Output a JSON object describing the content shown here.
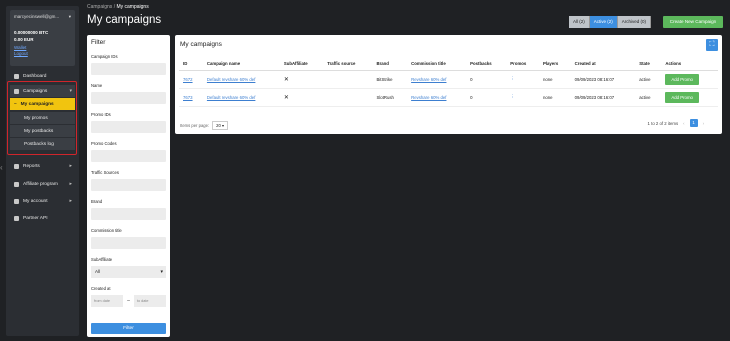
{
  "sidebar": {
    "email": "marcyecinswell@gm...",
    "btc": "0.00000000  BTC",
    "eur": "0.00  EUR",
    "wallet_link": "Wallet",
    "logout_link": "Logout",
    "items": {
      "dashboard": "Dashboard",
      "campaigns": "Campaigns",
      "my_campaigns": "My campaigns",
      "my_promos": "My promos",
      "my_postbacks": "My postbacks",
      "postbacks_log": "Postbacks log",
      "reports": "Reports",
      "affiliate_program": "Affiliate program",
      "my_account": "My account",
      "partner_api": "Partner API"
    }
  },
  "header": {
    "breadcrumb_parent": "Campaigns",
    "breadcrumb_sep": "/",
    "breadcrumb_current": "My campaigns",
    "title": "My campaigns",
    "filter_all": "All (2)",
    "filter_active": "Active (2)",
    "filter_archived": "Archived (0)",
    "create_button": "Create New Campaign"
  },
  "filter": {
    "title": "Filter",
    "campaign_ids": "Campaign IDs",
    "name": "Name",
    "promo_ids": "Promo IDs",
    "promo_codes": "Promo Codes",
    "traffic_sources": "Traffic Sources",
    "brand": "Brand",
    "commission_title": "Commission title",
    "subaffiliate": "SubAffiliate",
    "subaffiliate_value": "All",
    "created_at": "Created at",
    "from_placeholder": "from date",
    "to_placeholder": "to date",
    "filter_button": "Filter"
  },
  "main": {
    "title": "My campaigns",
    "columns": [
      "ID",
      "Campaign name",
      "SubAffiliate",
      "Traffic source",
      "Brand",
      "Commission title",
      "Postbacks",
      "Promos",
      "Players",
      "Created at",
      "State",
      "Actions"
    ],
    "rows": [
      {
        "id": "7672",
        "name": "Default revshare 60% def",
        "subaff": "✕",
        "traffic": "",
        "brand": "BitStrike",
        "commission": "Revshare 60% def",
        "postbacks": "0",
        "promos": "⋮",
        "players": "none",
        "created": "09/09/2023 08:16:07",
        "state": "active",
        "action": "Add Promo"
      },
      {
        "id": "7673",
        "name": "Default revshare 60% def",
        "subaff": "✕",
        "traffic": "",
        "brand": "SlotRush",
        "commission": "Revshare 60% def",
        "postbacks": "0",
        "promos": "⋮",
        "players": "none",
        "created": "09/09/2023 08:16:07",
        "state": "active",
        "action": "Add Promo"
      }
    ],
    "items_per_page_label": "Items per page:",
    "items_per_page": "20",
    "range": "1 to 2 of 2 items",
    "page": "1"
  }
}
